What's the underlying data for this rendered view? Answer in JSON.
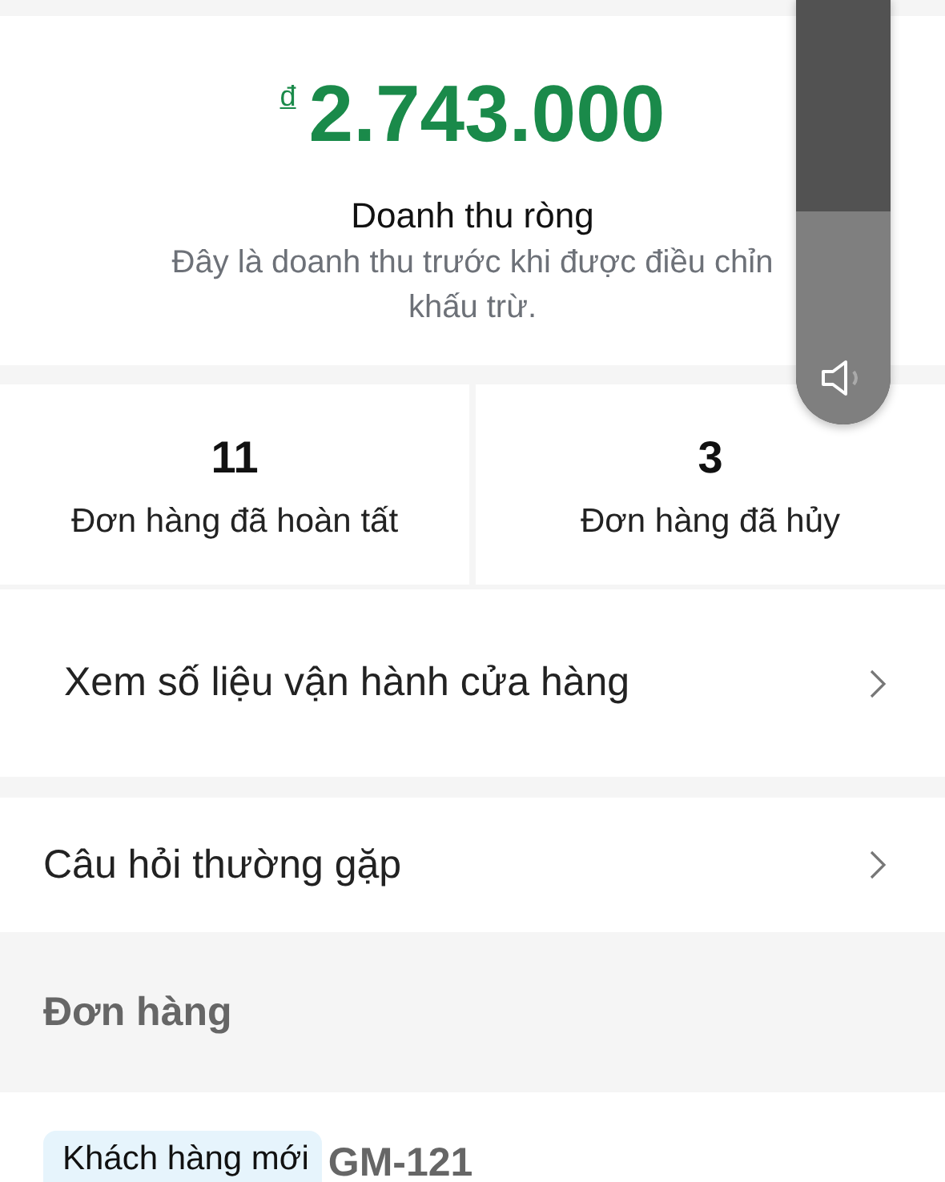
{
  "revenue": {
    "currency": "đ",
    "amount": "2.743.000",
    "label": "Doanh thu ròng",
    "description_lines": [
      "Đây là doanh thu trước khi được điều chỉn",
      "khấu trừ."
    ]
  },
  "stats": [
    {
      "value": "11",
      "label": "Đơn hàng đã hoàn tất"
    },
    {
      "value": "3",
      "label": "Đơn hàng đã hủy"
    }
  ],
  "links": [
    {
      "label": "Xem số liệu vận hành cửa hàng",
      "kind": "indented"
    },
    {
      "label": "Câu hỏi thường gặp",
      "kind": "plain"
    }
  ],
  "orders": {
    "title": "Đơn hàng",
    "items": [
      {
        "badge": "Khách hàng mới",
        "code": "GM-121"
      }
    ]
  },
  "volume": {
    "level": 0.5
  }
}
